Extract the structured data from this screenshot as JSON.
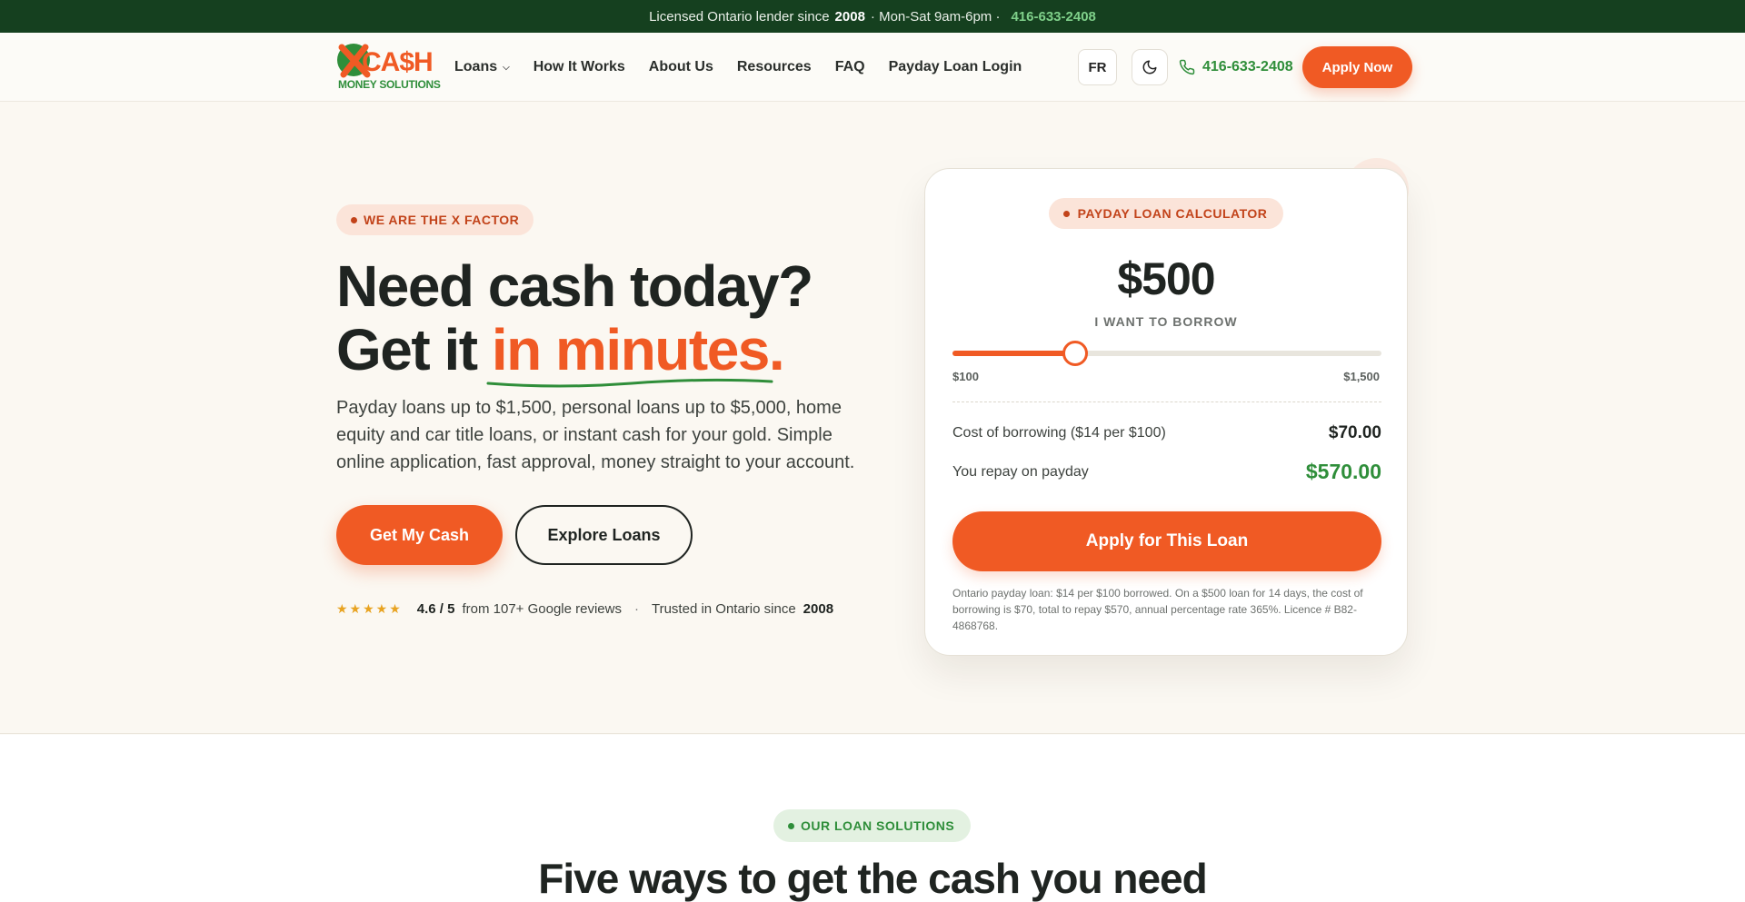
{
  "topbar": {
    "text_before": "Licensed Ontario lender since",
    "year": "2008",
    "hours": "· Mon-Sat 9am-6pm ·",
    "phone": "416-633-2408"
  },
  "header": {
    "logo": {
      "word": "CA$H",
      "sub": "MONEY SOLUTIONS"
    },
    "nav": [
      {
        "label": "Loans"
      },
      {
        "label": "How It Works"
      },
      {
        "label": "About Us"
      },
      {
        "label": "Resources"
      },
      {
        "label": "FAQ"
      },
      {
        "label": "Payday Loan Login"
      }
    ],
    "lang_button": "FR",
    "phone": "416-633-2408",
    "apply_button": "Apply Now"
  },
  "hero": {
    "badge": "WE ARE THE X FACTOR",
    "title_line1": "Need cash today?",
    "title_line2_prefix": "Get it ",
    "title_line2_accent": "in minutes.",
    "lead": "Payday loans up to $1,500, personal loans up to $5,000, home equity and car title loans, or instant cash for your gold. Simple online application, fast approval, money straight to your account.",
    "primary_button": "Get My Cash",
    "secondary_button": "Explore Loans",
    "stars": "★★★★★",
    "rating": "4.6 / 5",
    "rating_suffix": "from 107+ Google reviews",
    "separator": "·",
    "trusted_prefix": "Trusted in Ontario since",
    "trusted_year": "2008"
  },
  "calculator": {
    "badge": "PAYDAY LOAN CALCULATOR",
    "amount": "$500",
    "amount_label": "I WANT TO BORROW",
    "slider": {
      "min_label": "$100",
      "max_label": "$1,500",
      "min": 100,
      "max": 1500,
      "value": 500
    },
    "cost_label": "Cost of borrowing ($14 per $100)",
    "cost_value": "$70.00",
    "repay_label": "You repay on payday",
    "repay_value": "$570.00",
    "apply_button": "Apply for This Loan",
    "disclaimer": "Ontario payday loan: $14 per $100 borrowed. On a $500 loan for 14 days, the cost of borrowing is $70, total to repay $570, annual percentage rate 365%. Licence # B82-4868768."
  },
  "solutions": {
    "badge": "OUR LOAN SOLUTIONS",
    "title": "Five ways to get the cash you need"
  },
  "colors": {
    "brand_orange": "#f05a24",
    "brand_green": "#2f8e3a",
    "topbar_green": "#15401f"
  }
}
